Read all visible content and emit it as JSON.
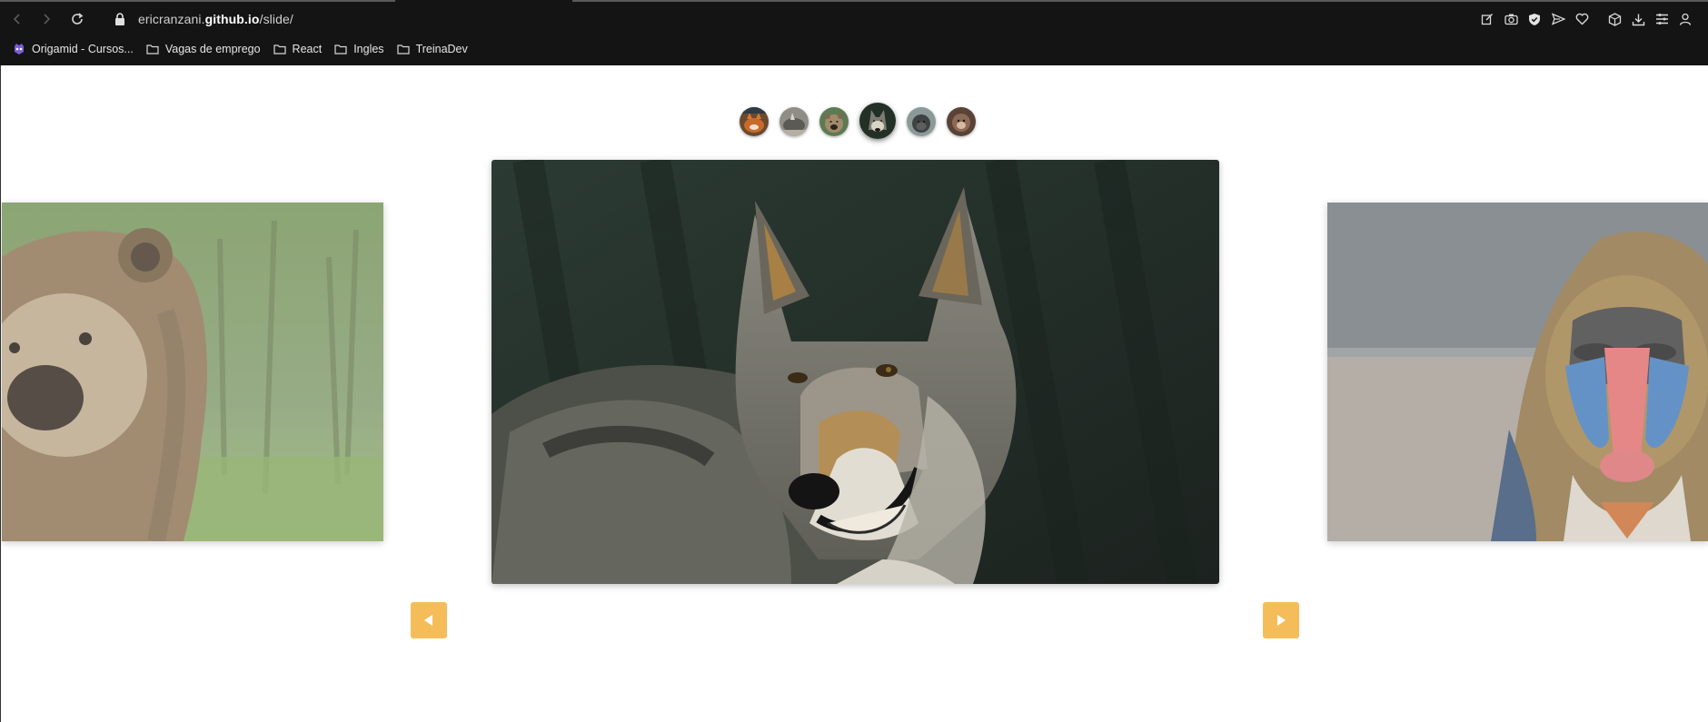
{
  "browser": {
    "url": {
      "domain_prefix": "ericranzani.",
      "domain_main": "github.io",
      "path": "/slide/"
    },
    "bookmarks": [
      {
        "label": "Origamid - Cursos...",
        "icon": "origamid-logo-icon"
      },
      {
        "label": "Vagas de emprego",
        "icon": "folder-icon"
      },
      {
        "label": "React",
        "icon": "folder-icon"
      },
      {
        "label": "Ingles",
        "icon": "folder-icon"
      },
      {
        "label": "TreinaDev",
        "icon": "folder-icon"
      }
    ],
    "toolbar_icons": [
      "edit-icon",
      "camera-icon",
      "shield-icon",
      "send-icon",
      "heart-icon",
      "cube-icon",
      "download-icon",
      "menu-icon",
      "account-icon"
    ]
  },
  "slideshow": {
    "thumbnails": [
      {
        "animal": "fox",
        "active": false
      },
      {
        "animal": "rhino",
        "active": false
      },
      {
        "animal": "bear",
        "active": false
      },
      {
        "animal": "wolf",
        "active": true
      },
      {
        "animal": "gorilla",
        "active": false
      },
      {
        "animal": "monkey",
        "active": false
      }
    ],
    "slides": {
      "previous": "bear",
      "current": "wolf",
      "next": "mandrill"
    },
    "controls": {
      "prev": "prev-arrow-icon",
      "next": "next-arrow-icon"
    },
    "colors": {
      "button": "#f5bd5a"
    }
  }
}
